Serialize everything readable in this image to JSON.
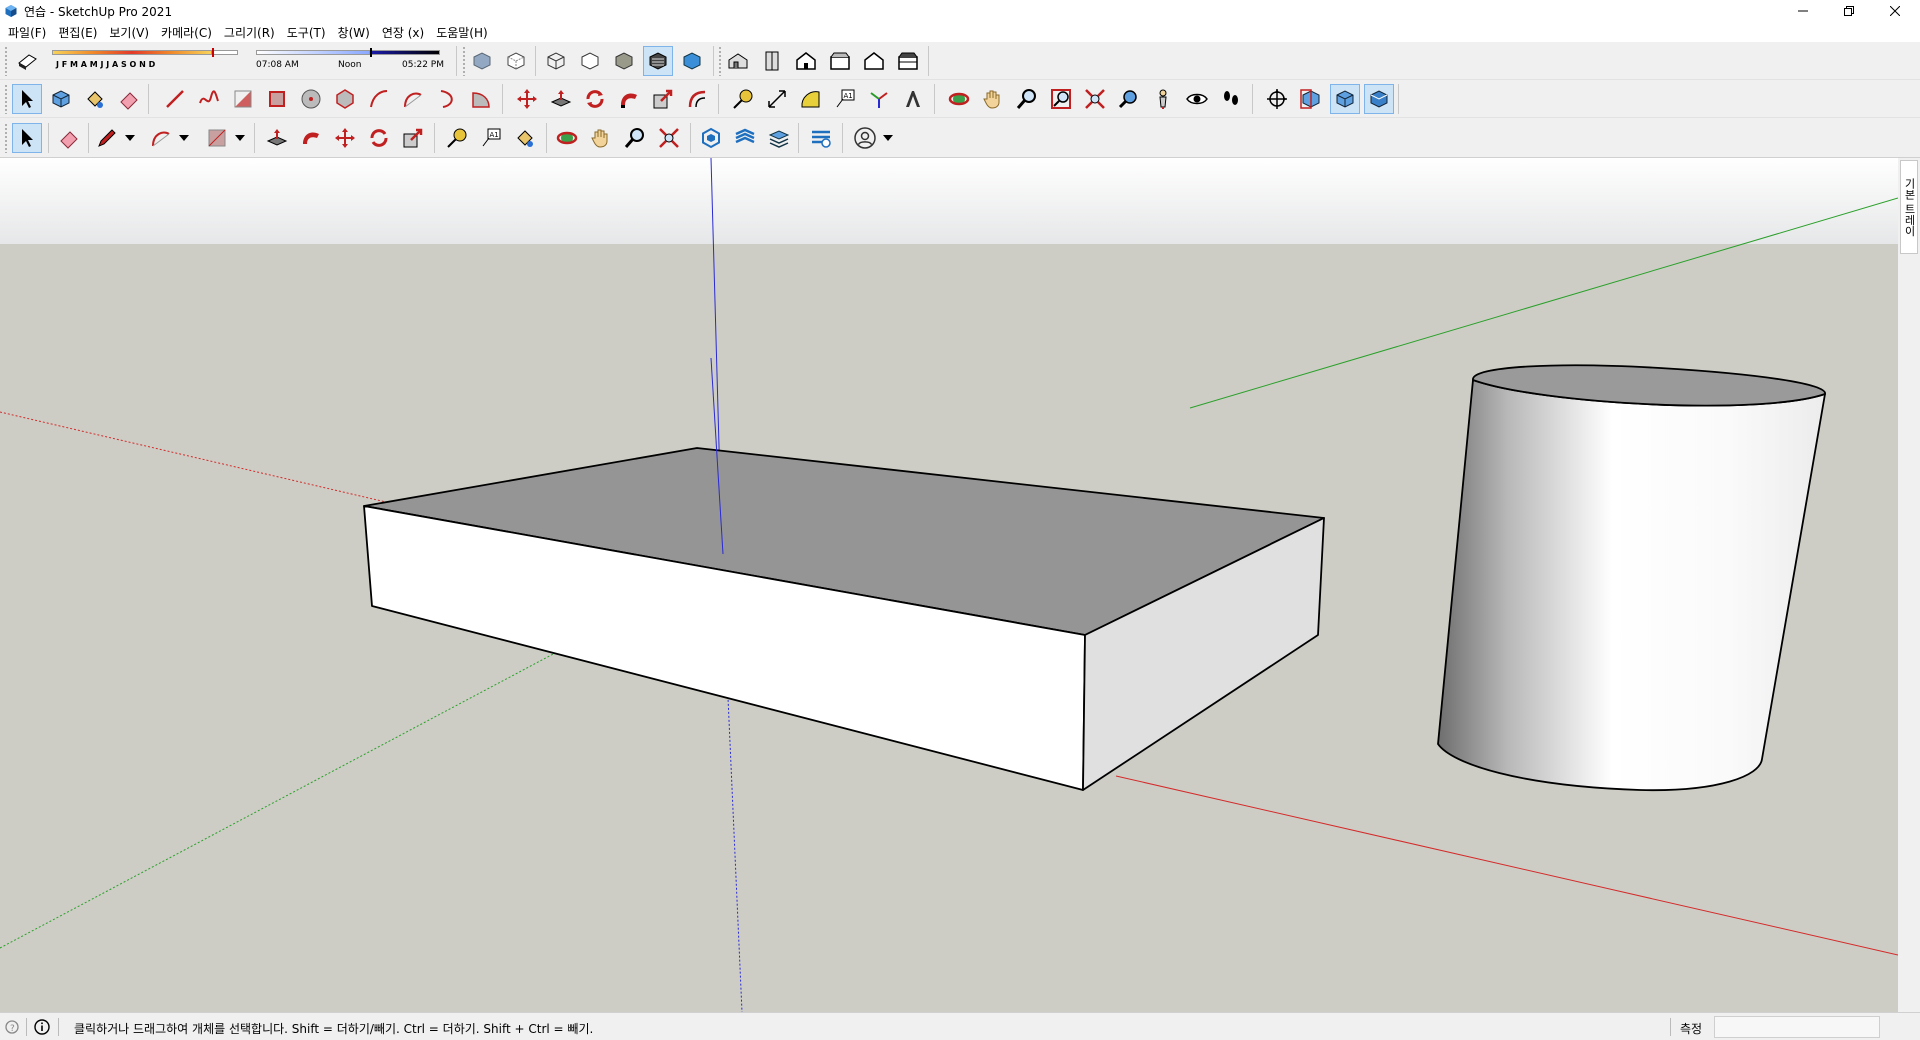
{
  "window": {
    "title": "연습 - SketchUp Pro 2021",
    "controls": [
      "minimize",
      "restore",
      "close"
    ]
  },
  "menu": [
    "파일(F)",
    "편집(E)",
    "보기(V)",
    "카메라(C)",
    "그리기(R)",
    "도구(T)",
    "창(W)",
    "연장 (x)",
    "도움말(H)"
  ],
  "shadows": {
    "months": "J F M A M J J A S O N D",
    "time_start": "07:08 AM",
    "time_mid": "Noon",
    "time_end": "05:22 PM"
  },
  "toolbars": {
    "row1": [
      "shadows-toggle-icon",
      "style-xray-icon",
      "style-back-edges-icon",
      "style-wireframe-icon",
      "style-hidden-line-icon",
      "style-shaded-icon",
      "style-shaded-textures-icon",
      "style-monochrome-icon",
      "view-iso-icon",
      "view-top-icon",
      "view-front-icon",
      "view-right-icon",
      "view-back-icon",
      "view-left-icon"
    ],
    "row2": [
      "select-icon",
      "make-component-icon",
      "paint-bucket-icon",
      "eraser-icon",
      "line-icon",
      "freehand-icon",
      "rectangle-icon",
      "rotated-rectangle-icon",
      "circle-icon",
      "polygon-icon",
      "arc-icon",
      "two-point-arc-icon",
      "three-point-arc-icon",
      "pie-icon",
      "move-icon",
      "push-pull-icon",
      "rotate-icon",
      "follow-me-icon",
      "scale-icon",
      "offset-icon",
      "tape-measure-icon",
      "dimension-icon",
      "protractor-icon",
      "text-icon",
      "axes-icon",
      "3d-text-icon",
      "orbit-icon",
      "pan-icon",
      "zoom-icon",
      "zoom-window-icon",
      "zoom-extents-icon",
      "position-camera-icon",
      "walk-icon",
      "look-around-icon",
      "footprints-icon",
      "section-plane-icon",
      "display-section-planes-icon",
      "display-section-cuts-icon",
      "display-section-fill-icon"
    ],
    "row3": [
      "select-icon",
      "eraser-icon",
      "pencil-icon",
      "arc-icon",
      "rectangle-icon",
      "push-pull-icon",
      "follow-me-icon",
      "move-icon",
      "rotate-icon",
      "scale-icon",
      "tape-measure-icon",
      "text-icon",
      "paint-bucket-icon",
      "orbit-icon",
      "pan-icon",
      "zoom-icon",
      "zoom-extents-icon",
      "solid-tools-icon",
      "sandbox-icon",
      "layers-icon",
      "warehouse-icon",
      "account-icon"
    ]
  },
  "tray": {
    "tab_label": "기본 트레이"
  },
  "status": {
    "hint": "클릭하거나 드래그하여 개체를 선택합니다. Shift = 더하기/빼기. Ctrl = 더하기. Shift + Ctrl = 빼기.",
    "measure_label": "측정",
    "measure_value": ""
  },
  "colors": {
    "axis_red": "#d42a2a",
    "axis_green": "#2aa02a",
    "axis_blue": "#2a2ad4",
    "ground": "#cdcdc5",
    "sky": "#ffffff",
    "face_top": "#959595",
    "face_front": "#ffffff",
    "face_side": "#e0e0e0",
    "active_tool": "#cde4f7"
  }
}
